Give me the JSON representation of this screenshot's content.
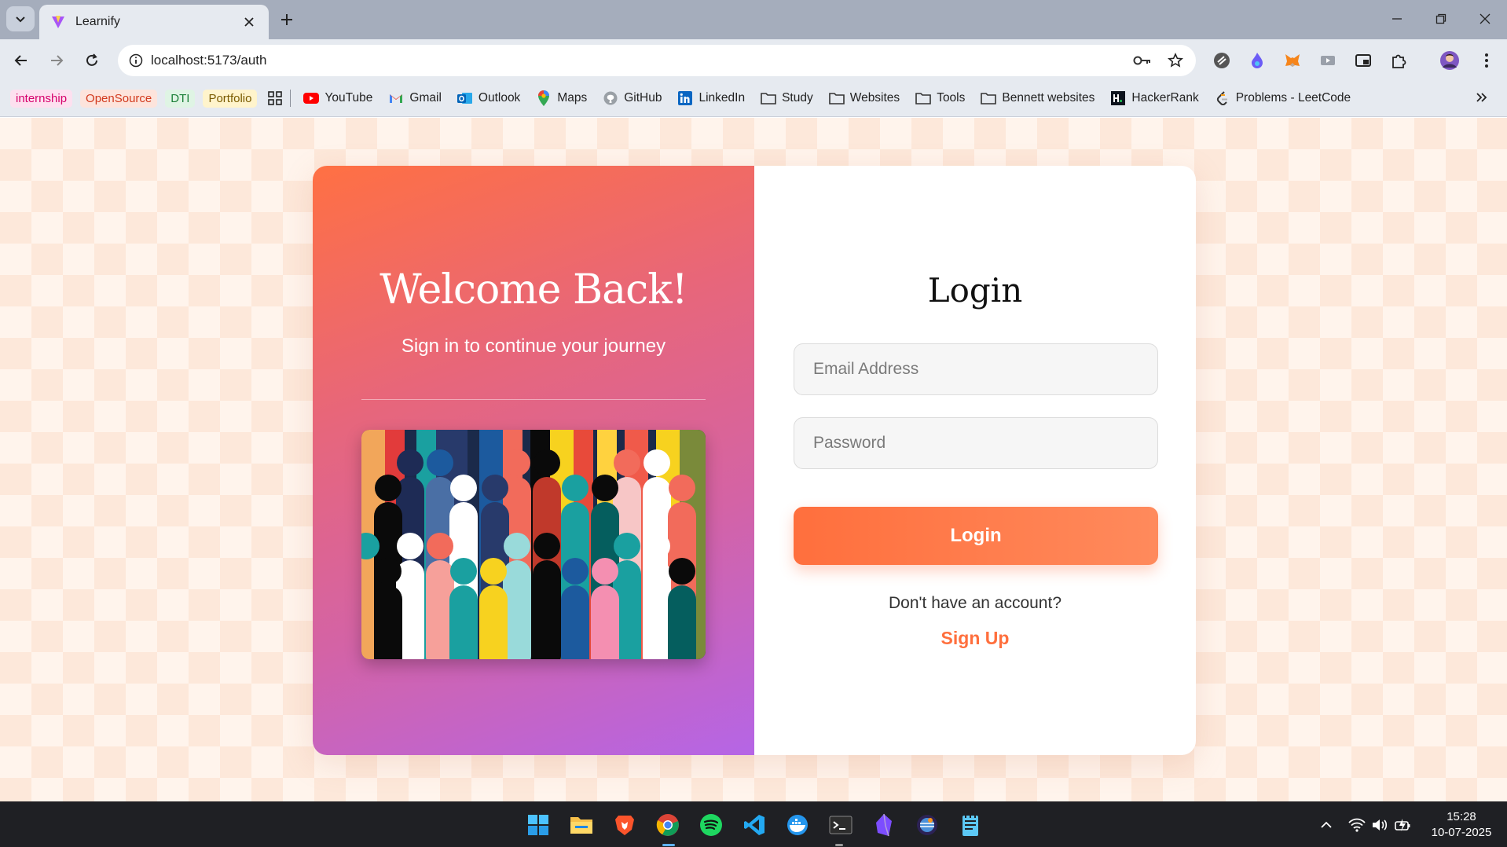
{
  "browser": {
    "tab_title": "Learnify",
    "url": "localhost:5173/auth",
    "bookmark_chips": [
      {
        "label": "internship",
        "color": "#d6006c",
        "bg": "#fde0ef"
      },
      {
        "label": "OpenSource",
        "color": "#d23a1d",
        "bg": "#fde4dc"
      },
      {
        "label": "DTI",
        "color": "#1a7f37",
        "bg": "#dff4e4"
      },
      {
        "label": "Portfolio",
        "color": "#7a5b00",
        "bg": "#fff4cc"
      }
    ],
    "bookmarks": [
      {
        "label": "YouTube",
        "icon": "youtube-icon"
      },
      {
        "label": "Gmail",
        "icon": "gmail-icon"
      },
      {
        "label": "Outlook",
        "icon": "outlook-icon"
      },
      {
        "label": "Maps",
        "icon": "maps-icon"
      },
      {
        "label": "GitHub",
        "icon": "github-icon"
      },
      {
        "label": "LinkedIn",
        "icon": "linkedin-icon"
      },
      {
        "label": "Study",
        "icon": "folder-icon"
      },
      {
        "label": "Websites",
        "icon": "folder-icon"
      },
      {
        "label": "Tools",
        "icon": "folder-icon"
      },
      {
        "label": "Bennett websites",
        "icon": "folder-icon"
      },
      {
        "label": "HackerRank",
        "icon": "hackerrank-icon"
      },
      {
        "label": "Problems - LeetCode",
        "icon": "leetcode-icon"
      }
    ]
  },
  "auth": {
    "welcome_title": "Welcome Back!",
    "welcome_subtitle": "Sign in to continue your journey",
    "login_title": "Login",
    "email_placeholder": "Email Address",
    "password_placeholder": "Password",
    "login_button": "Login",
    "no_account_text": "Don't have an account?",
    "signup_link": "Sign Up"
  },
  "colors": {
    "accent": "#ff6f3d",
    "gradient_start": "#ff7043",
    "gradient_end": "#b565e6"
  },
  "taskbar": {
    "time": "15:28",
    "date": "10-07-2025",
    "apps": [
      "windows-start-icon",
      "file-explorer-icon",
      "brave-icon",
      "chrome-icon",
      "spotify-icon",
      "vscode-icon",
      "docker-icon",
      "terminal-icon",
      "obsidian-icon",
      "eclipse-icon",
      "notepad-icon"
    ]
  }
}
